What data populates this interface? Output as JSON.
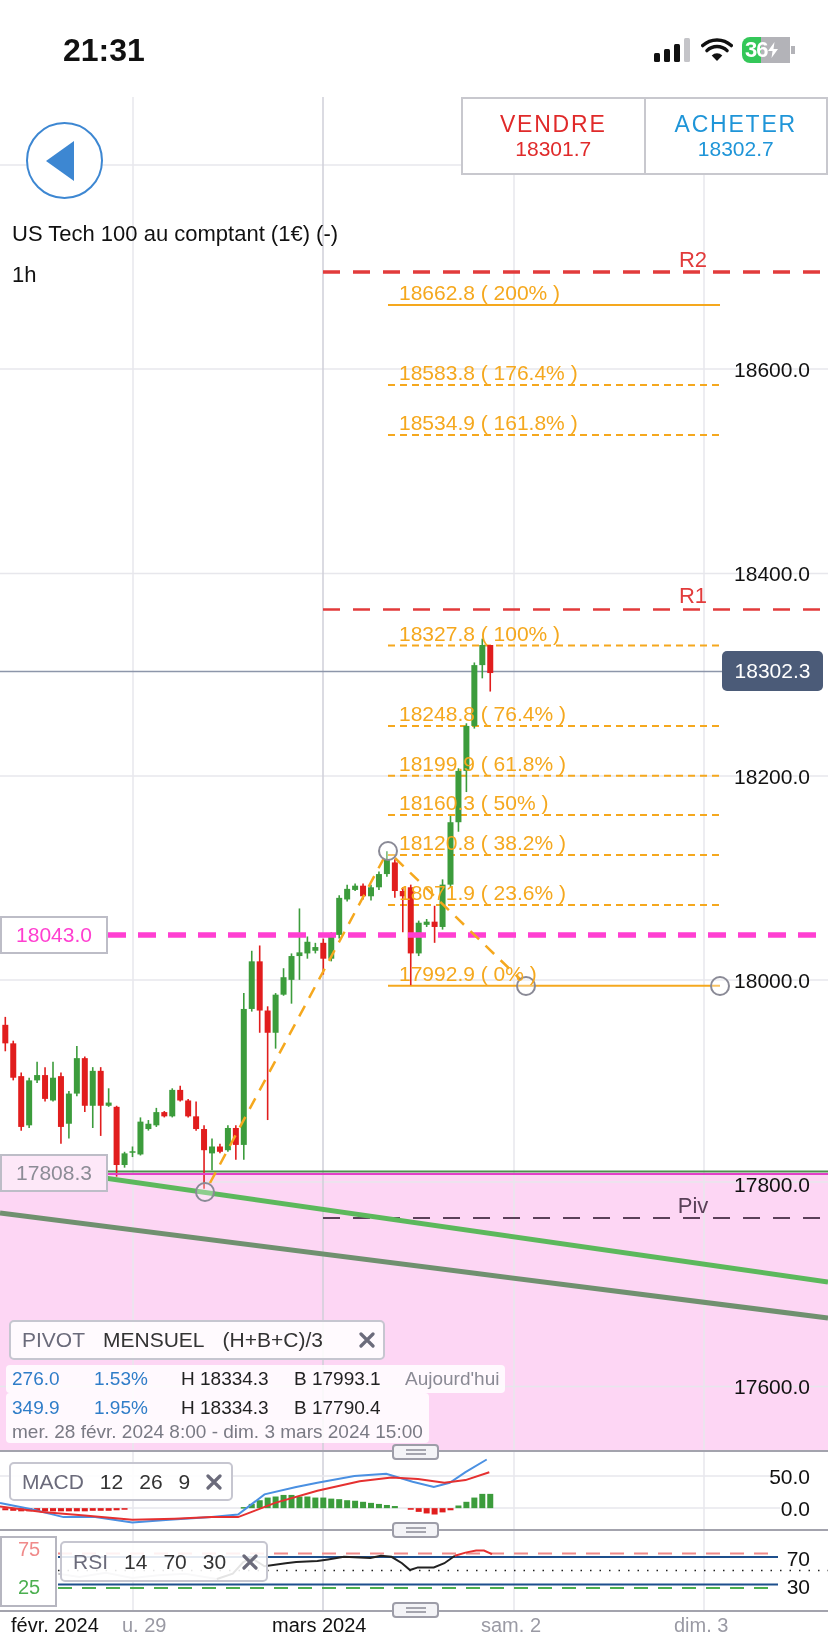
{
  "status_bar": {
    "time": "21:31",
    "battery": "36"
  },
  "trade_buttons": [
    {
      "kind": "sell",
      "label": "VENDRE",
      "price": "18301.7"
    },
    {
      "kind": "buy",
      "label": "ACHETER",
      "price": "18302.7"
    }
  ],
  "instrument": {
    "name": "US Tech 100 au comptant (1€) (-)",
    "timeframe": "1h"
  },
  "price_axis": [
    "18600.0",
    "18400.0",
    "18200.0",
    "18000.0",
    "17800.0",
    "17600.0"
  ],
  "pivot_levels": [
    {
      "label": "R2",
      "kind": "resistance"
    },
    {
      "label": "R1",
      "kind": "resistance"
    },
    {
      "label": "Piv",
      "kind": "pivot"
    }
  ],
  "fibonacci": [
    {
      "label": "18662.8 ( 200% )",
      "kind": "solid"
    },
    {
      "label": "18583.8 ( 176.4% )",
      "kind": "dashed"
    },
    {
      "label": "18534.9 ( 161.8% )",
      "kind": "dashed"
    },
    {
      "label": "18327.8 ( 100% )",
      "kind": "dashed"
    },
    {
      "label": "18248.8 ( 76.4% )",
      "kind": "dashed"
    },
    {
      "label": "18199.9 ( 61.8% )",
      "kind": "dashed"
    },
    {
      "label": "18160.3 ( 50% )",
      "kind": "dashed"
    },
    {
      "label": "18120.8 ( 38.2% )",
      "kind": "dashed"
    },
    {
      "label": "18071.9 ( 23.6% )",
      "kind": "dashed"
    },
    {
      "label": "17992.9 ( 0% )",
      "kind": "solid"
    }
  ],
  "current_price": "18302.3",
  "alert_lines": [
    {
      "label": "18043.0",
      "kind": "dashed"
    },
    {
      "label": "17808.3",
      "kind": "solid"
    }
  ],
  "pivot_legend": {
    "name": "PIVOT",
    "period": "MENSUEL",
    "formula": "(H+B+C)/3"
  },
  "pivot_stats": {
    "rows": [
      {
        "points": "276.0",
        "percent": "1.53%",
        "high": "H 18334.3",
        "low": "B 17993.1",
        "period": "Aujourd'hui"
      },
      {
        "points": "349.9",
        "percent": "1.95%",
        "high": "H 18334.3",
        "low": "B 17790.4"
      }
    ],
    "range": "mer. 28 févr. 2024 8:00 - dim. 3 mars 2024 15:00"
  },
  "macd": {
    "name": "MACD",
    "params": [
      "12",
      "26",
      "9"
    ],
    "axis": [
      "50.0",
      "0.0"
    ]
  },
  "rsi": {
    "name": "RSI",
    "params": [
      "14",
      "70",
      "30"
    ],
    "bands": [
      "75",
      "25"
    ],
    "axis": [
      "70",
      "30"
    ]
  },
  "time_axis": [
    {
      "label": "févr. 2024",
      "kind": "month"
    },
    {
      "label": "u. 29",
      "kind": "day"
    },
    {
      "label": "mars 2024",
      "kind": "month"
    },
    {
      "label": "sam. 2",
      "kind": "day"
    },
    {
      "label": "dim. 3",
      "kind": "day"
    }
  ]
}
